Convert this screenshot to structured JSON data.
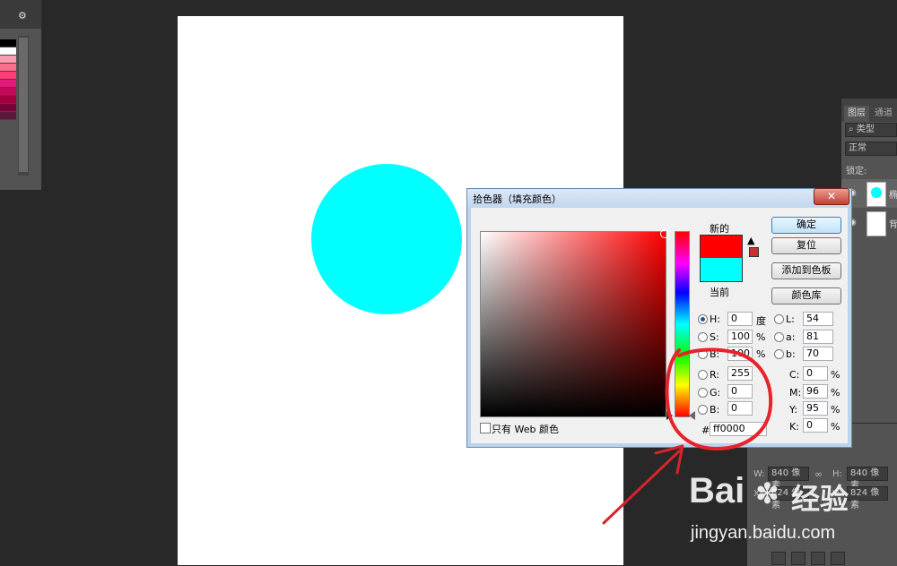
{
  "left_swatches": {
    "gear_icon": "⚙",
    "colors": [
      "#000000",
      "#fefefe",
      "#ff9bb0",
      "#ff6e8f",
      "#ff3c78",
      "#e4177a",
      "#c00a5a",
      "#a0003e",
      "#7a003a",
      "#5c1a3a"
    ]
  },
  "canvas": {
    "circle_color": "#00ffff"
  },
  "layers_panel": {
    "tabs": [
      "图层",
      "通道"
    ],
    "filter_label": "类型",
    "blend_mode": "正常",
    "lock_label": "锁定:",
    "layer_name_partial": "椭",
    "layer2_name_partial": "背"
  },
  "properties_panel": {
    "w_label": "W:",
    "h_label": "H:",
    "w_value": "840 像素",
    "h_value": "840 像素",
    "x_label": "X:",
    "y_label": "Y:",
    "x_value": "824 像素",
    "y_value": "824 像素"
  },
  "color_picker": {
    "title": "拾色器（填充颜色）",
    "close_symbol": "✕",
    "new_label": "新的",
    "current_label": "当前",
    "new_color": "#ff0000",
    "current_color": "#00ffff",
    "warning_icon": "▲",
    "buttons": {
      "ok": "确定",
      "reset": "复位",
      "add_swatch": "添加到色板",
      "libraries": "颜色库"
    },
    "hsb": {
      "h_label": "H:",
      "h_value": "0",
      "h_unit": "度",
      "s_label": "S:",
      "s_value": "100",
      "s_unit": "%",
      "b_label": "B:",
      "b_value": "100",
      "b_unit": "%"
    },
    "rgb": {
      "r_label": "R:",
      "r_value": "255",
      "g_label": "G:",
      "g_value": "0",
      "b_label": "B:",
      "b_value": "0"
    },
    "lab": {
      "l_label": "L:",
      "l_value": "54",
      "a_label": "a:",
      "a_value": "81",
      "b_label": "b:",
      "b_value": "70"
    },
    "cmyk": {
      "c_label": "C:",
      "c_value": "0",
      "m_label": "M:",
      "m_value": "96",
      "y_label": "Y:",
      "y_value": "95",
      "k_label": "K:",
      "k_value": "0",
      "unit": "%"
    },
    "hex_label": "#",
    "hex_value": "ff0000",
    "web_only_label": "只有 Web 颜色"
  },
  "watermark": {
    "brand": "Bai",
    "brand_cn": "经验",
    "url": "jingyan.baidu.com"
  }
}
